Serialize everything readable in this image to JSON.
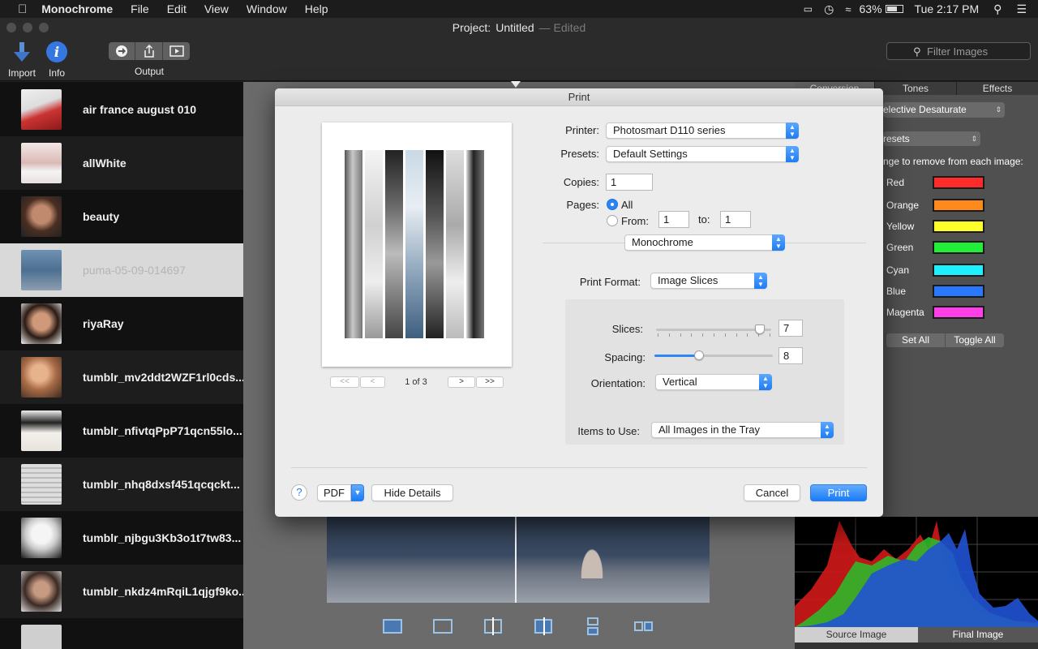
{
  "menubar": {
    "app_name": "Monochrome",
    "items": [
      "File",
      "Edit",
      "View",
      "Window",
      "Help"
    ],
    "battery": "63%",
    "clock": "Tue 2:17 PM"
  },
  "window": {
    "title_prefix": "Project:",
    "title_name": "Untitled",
    "title_status": "— Edited"
  },
  "toolbar": {
    "import_label": "Import",
    "info_label": "Info",
    "output_label": "Output",
    "filter_placeholder": "Filter Images"
  },
  "sidebar": {
    "items": [
      {
        "name": "air france august 010",
        "selected": false
      },
      {
        "name": "allWhite",
        "selected": false
      },
      {
        "name": "beauty",
        "selected": false
      },
      {
        "name": "puma-05-09-014697",
        "selected": true
      },
      {
        "name": "riyaRay",
        "selected": false
      },
      {
        "name": "tumblr_mv2ddt2WZF1rl0cds...",
        "selected": false
      },
      {
        "name": "tumblr_nfivtqPpP71qcn55lo...",
        "selected": false
      },
      {
        "name": "tumblr_nhq8dxsf451qcqckt...",
        "selected": false
      },
      {
        "name": "tumblr_njbgu3Kb3o1t7tw83...",
        "selected": false
      },
      {
        "name": "tumblr_nkdz4mRqiL1qjgf9ko...",
        "selected": false
      }
    ]
  },
  "right_panel": {
    "tabs": [
      "Conversion",
      "Tones",
      "Effects"
    ],
    "method": "elective Desaturate",
    "presets": "resets",
    "instruction": "nge to remove from each image:",
    "colors": [
      {
        "name": "Red",
        "hex": "#ff2a2a"
      },
      {
        "name": "Orange",
        "hex": "#ff8a1c"
      },
      {
        "name": "Yellow",
        "hex": "#ffff2a"
      },
      {
        "name": "Green",
        "hex": "#22ee3a"
      },
      {
        "name": "Cyan",
        "hex": "#1ff0ff"
      },
      {
        "name": "Blue",
        "hex": "#2a78ff"
      },
      {
        "name": "Magenta",
        "hex": "#ff3ee8"
      }
    ],
    "set_all": "Set All",
    "toggle_all": "Toggle All",
    "source_image": "Source Image",
    "final_image": "Final Image"
  },
  "print_dialog": {
    "title": "Print",
    "printer_label": "Printer:",
    "printer_value": "Photosmart D110 series",
    "presets_label": "Presets:",
    "presets_value": "Default Settings",
    "copies_label": "Copies:",
    "copies_value": "1",
    "pages_label": "Pages:",
    "pages_all": "All",
    "pages_from": "From:",
    "from_value": "1",
    "pages_to": "to:",
    "to_value": "1",
    "section_value": "Monochrome",
    "print_format_label": "Print Format:",
    "print_format_value": "Image Slices",
    "slices_label": "Slices:",
    "slices_value": "7",
    "slices_level": 0.9,
    "spacing_label": "Spacing:",
    "spacing_value": "8",
    "spacing_level": 0.38,
    "orientation_label": "Orientation:",
    "orientation_value": "Vertical",
    "items_label": "Items to Use:",
    "items_value": "All Images in the Tray",
    "page_indicator": "1 of 3",
    "help": "?",
    "pdf": "PDF",
    "hide_details": "Hide Details",
    "cancel": "Cancel",
    "print": "Print"
  }
}
